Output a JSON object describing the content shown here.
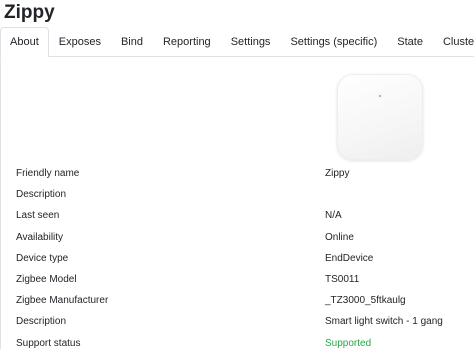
{
  "page_title": "Zippy",
  "tabs": [
    {
      "label": "About"
    },
    {
      "label": "Exposes"
    },
    {
      "label": "Bind"
    },
    {
      "label": "Reporting"
    },
    {
      "label": "Settings"
    },
    {
      "label": "Settings (specific)"
    },
    {
      "label": "State"
    },
    {
      "label": "Clusters"
    }
  ],
  "active_tab": "About",
  "details": [
    {
      "label": "Friendly name",
      "value": "Zippy"
    },
    {
      "label": "Description",
      "value": ""
    },
    {
      "label": "Last seen",
      "value": "N/A"
    },
    {
      "label": "Availability",
      "value": "Online"
    },
    {
      "label": "Device type",
      "value": "EndDevice"
    },
    {
      "label": "Zigbee Model",
      "value": "TS0011"
    },
    {
      "label": "Zigbee Manufacturer",
      "value": "_TZ3000_5ftkaulg"
    },
    {
      "label": "Description",
      "value": "Smart light switch - 1 gang"
    },
    {
      "label": "Support status",
      "value": "Supported"
    }
  ],
  "colors": {
    "supported": "#28a745",
    "border": "#dee2e6"
  }
}
